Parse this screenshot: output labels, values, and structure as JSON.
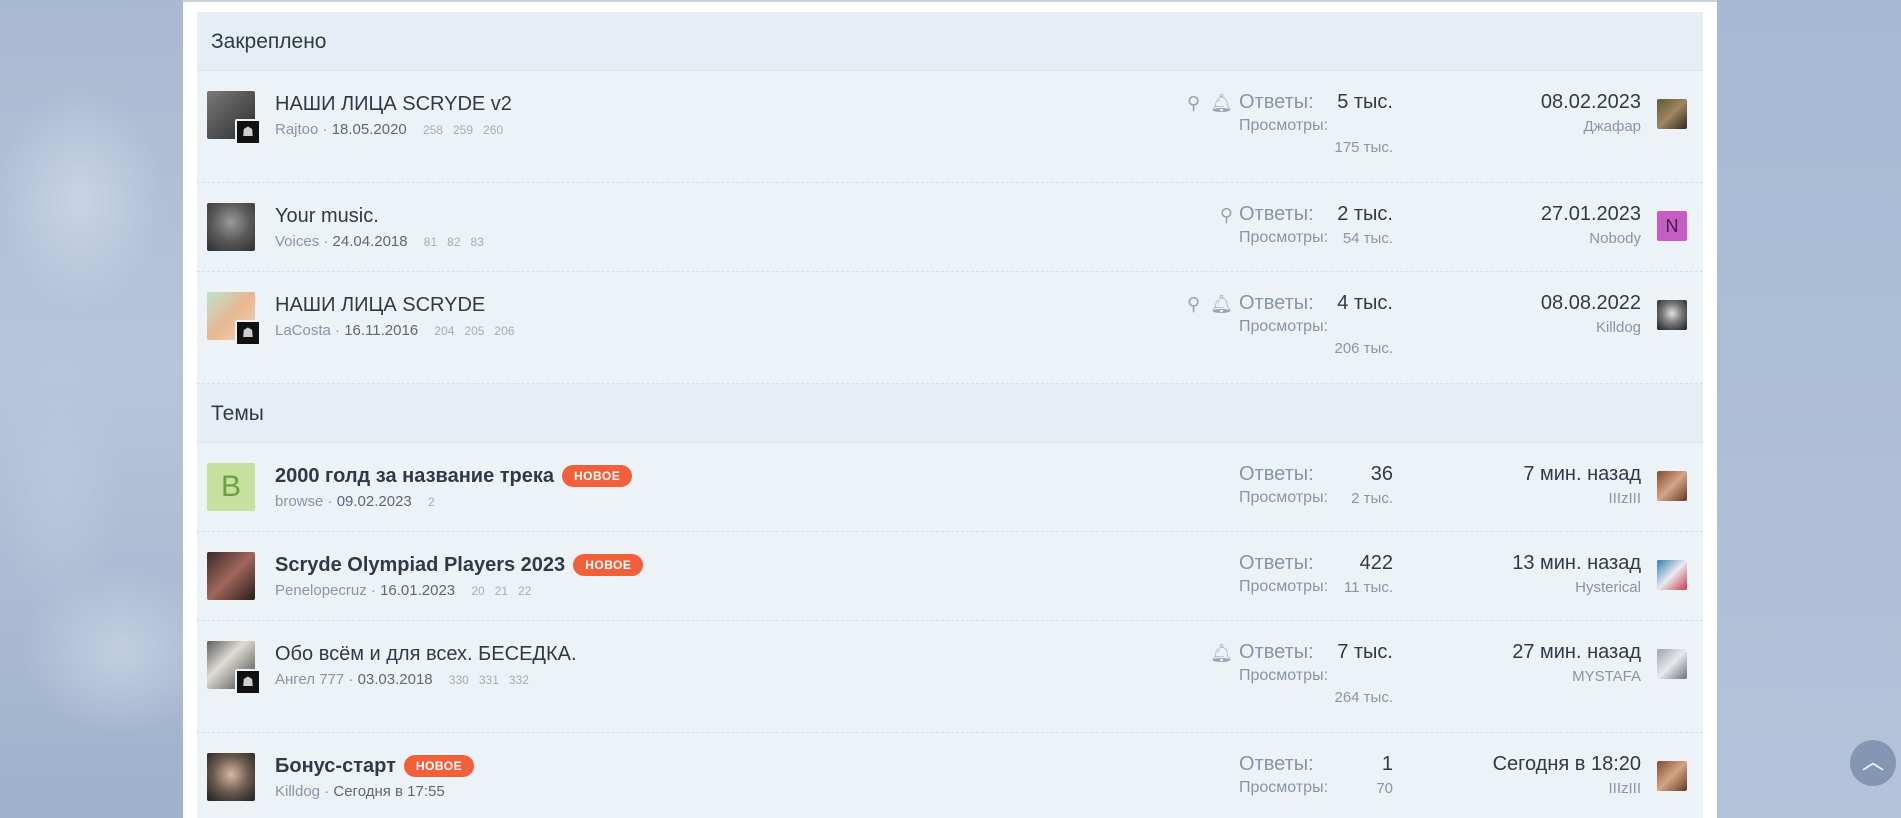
{
  "sections": {
    "pinned_title": "Закреплено",
    "topics_title": "Темы"
  },
  "labels": {
    "replies": "Ответы:",
    "views": "Просмотры:",
    "new_badge": "НОВОЕ"
  },
  "pinned": [
    {
      "title": "НАШИ ЛИЦА SCRYDE v2",
      "author": "Rajtoo",
      "date": "18.05.2020",
      "pages": [
        "258",
        "259",
        "260"
      ],
      "replies": "5 тыс.",
      "views": "175 тыс.",
      "last_date": "08.02.2023",
      "last_user": "Джафар",
      "icons": [
        "pin-icon",
        "bell-icon"
      ]
    },
    {
      "title": "Your music.",
      "author": "Voices",
      "date": "24.04.2018",
      "pages": [
        "81",
        "82",
        "83"
      ],
      "replies": "2 тыс.",
      "views": "54 тыс.",
      "last_date": "27.01.2023",
      "last_user": "Nobody",
      "last_avatar_letter": "N",
      "icons": [
        "pin-icon"
      ]
    },
    {
      "title": "НАШИ ЛИЦА SCRYDE",
      "author": "LaCosta",
      "date": "16.11.2016",
      "pages": [
        "204",
        "205",
        "206"
      ],
      "replies": "4 тыс.",
      "views": "206 тыс.",
      "last_date": "08.08.2022",
      "last_user": "Killdog",
      "icons": [
        "pin-icon",
        "bell-icon"
      ]
    }
  ],
  "topics": [
    {
      "title": "2000 голд за название трека",
      "avatar_letter": "B",
      "author": "browse",
      "date": "09.02.2023",
      "pages": [
        "2"
      ],
      "replies": "36",
      "views": "2 тыс.",
      "last_date": "7 мин. назад",
      "last_user": "IIIzIII"
    },
    {
      "title": "Scryde Olympiad Players 2023",
      "author": "Penelopecruz",
      "date": "16.01.2023",
      "pages": [
        "20",
        "21",
        "22"
      ],
      "replies": "422",
      "views": "11 тыс.",
      "last_date": "13 мин. назад",
      "last_user": "Hysterical"
    },
    {
      "title": "Обо всём и для всех. БЕСЕДКА.",
      "author": "Ангел 777",
      "date": "03.03.2018",
      "pages": [
        "330",
        "331",
        "332"
      ],
      "replies": "7 тыс.",
      "views": "264 тыс.",
      "last_date": "27 мин. назад",
      "last_user": "MYSTAFA",
      "icons": [
        "bell-icon"
      ]
    },
    {
      "title": "Бонус-старт",
      "author": "Killdog",
      "date": "Сегодня в 17:55",
      "replies": "1",
      "views": "70",
      "last_date": "Сегодня в 18:20",
      "last_user": "IIIzIII"
    }
  ],
  "colors": {
    "accent_badge": "#f0603a",
    "header_bg": "#e7edf5",
    "row_bg": "#edf2f7"
  }
}
